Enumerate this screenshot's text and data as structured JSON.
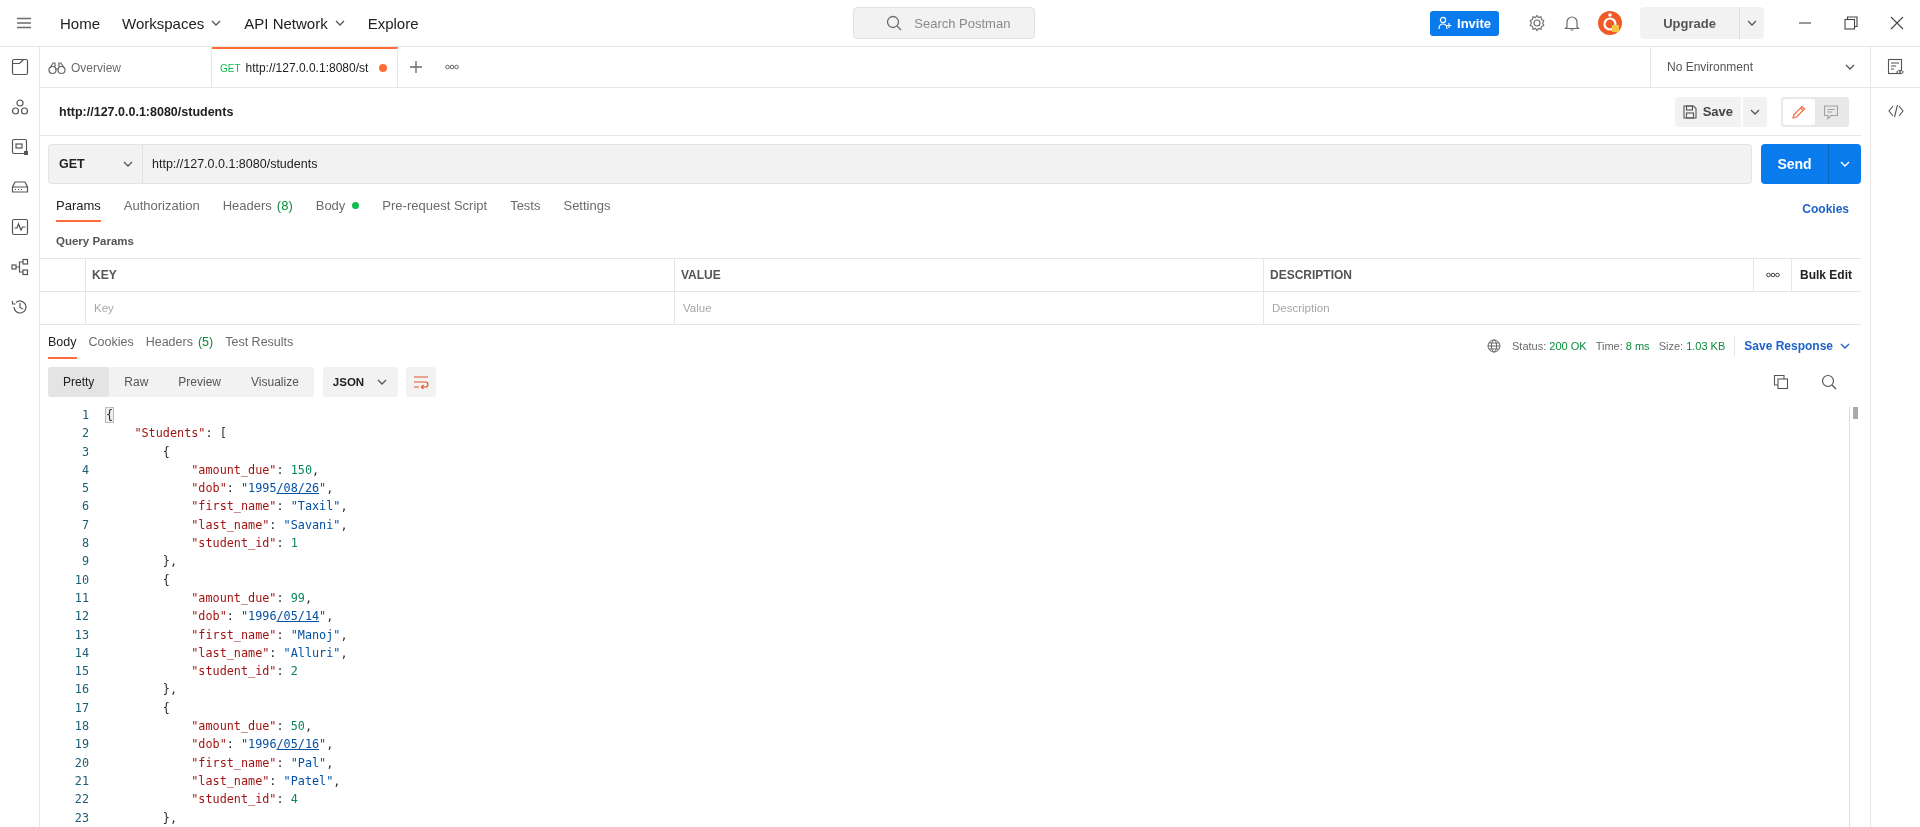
{
  "top_bar": {
    "nav": [
      {
        "label": "Home",
        "dropdown": false
      },
      {
        "label": "Workspaces",
        "dropdown": true
      },
      {
        "label": "API Network",
        "dropdown": true
      },
      {
        "label": "Explore",
        "dropdown": false
      }
    ],
    "search": {
      "placeholder": "Search Postman"
    },
    "invite": "Invite",
    "upgrade": "Upgrade"
  },
  "tabs": [
    {
      "kind": "overview",
      "label": "Overview",
      "selected": false
    },
    {
      "kind": "request",
      "method": "GET",
      "label": "http://127.0.0.1:8080/st",
      "unsaved": true,
      "selected": true
    }
  ],
  "environment": {
    "label": "No Environment"
  },
  "request": {
    "name": "http://127.0.0.1:8080/students",
    "save": "Save",
    "modes": [
      {
        "kind": "edit",
        "selected": true
      },
      {
        "kind": "comments",
        "selected": false
      }
    ],
    "method": "GET",
    "url": "http://127.0.0.1:8080/students",
    "send": "Send",
    "tabs": [
      {
        "label": "Params",
        "selected": true
      },
      {
        "label": "Authorization",
        "selected": false
      },
      {
        "label": "Headers",
        "count": "(8)",
        "selected": false
      },
      {
        "label": "Body",
        "dot": true,
        "selected": false
      },
      {
        "label": "Pre-request Script",
        "selected": false
      },
      {
        "label": "Tests",
        "selected": false
      },
      {
        "label": "Settings",
        "selected": false
      }
    ],
    "cookies": "Cookies"
  },
  "query_params": {
    "title": "Query Params",
    "columns": [
      "KEY",
      "VALUE",
      "DESCRIPTION"
    ],
    "bulk_edit": "Bulk Edit",
    "placeholders": [
      "Key",
      "Value",
      "Description"
    ]
  },
  "response": {
    "tabs": [
      {
        "label": "Body",
        "selected": true
      },
      {
        "label": "Cookies",
        "selected": false
      },
      {
        "label": "Headers",
        "count": "(5)",
        "selected": false
      },
      {
        "label": "Test Results",
        "selected": false
      }
    ],
    "stats": [
      {
        "label": "Status:",
        "value": "200 OK"
      },
      {
        "label": "Time:",
        "value": "8 ms"
      },
      {
        "label": "Size:",
        "value": "1.03 KB"
      }
    ],
    "save_response": "Save Response",
    "views": [
      {
        "label": "Pretty",
        "selected": true
      },
      {
        "label": "Raw",
        "selected": false
      },
      {
        "label": "Preview",
        "selected": false
      },
      {
        "label": "Visualize",
        "selected": false
      }
    ],
    "format": "JSON",
    "lines": [
      {
        "number": "1",
        "tokens": [
          {
            "kind": "brace",
            "text": "{"
          }
        ]
      },
      {
        "number": "2",
        "tokens": [
          {
            "kind": "key",
            "text": "    \"Students\""
          },
          {
            "kind": "punct",
            "text": ": ["
          }
        ]
      },
      {
        "number": "3",
        "tokens": [
          {
            "kind": "punct",
            "text": "        {"
          }
        ]
      },
      {
        "number": "4",
        "tokens": [
          {
            "kind": "key",
            "text": "            \"amount_due\""
          },
          {
            "kind": "punct",
            "text": ": "
          },
          {
            "kind": "number",
            "text": "150"
          },
          {
            "kind": "punct",
            "text": ","
          }
        ]
      },
      {
        "number": "5",
        "tokens": [
          {
            "kind": "key",
            "text": "            \"dob\""
          },
          {
            "kind": "punct",
            "text": ": "
          },
          {
            "kind": "string",
            "text": "\"1995"
          },
          {
            "kind": "link",
            "text": "/08/26"
          },
          {
            "kind": "string",
            "text": "\""
          },
          {
            "kind": "punct",
            "text": ","
          }
        ]
      },
      {
        "number": "6",
        "tokens": [
          {
            "kind": "key",
            "text": "            \"first_name\""
          },
          {
            "kind": "punct",
            "text": ": "
          },
          {
            "kind": "string",
            "text": "\"Taxil\""
          },
          {
            "kind": "punct",
            "text": ","
          }
        ]
      },
      {
        "number": "7",
        "tokens": [
          {
            "kind": "key",
            "text": "            \"last_name\""
          },
          {
            "kind": "punct",
            "text": ": "
          },
          {
            "kind": "string",
            "text": "\"Savani\""
          },
          {
            "kind": "punct",
            "text": ","
          }
        ]
      },
      {
        "number": "8",
        "tokens": [
          {
            "kind": "key",
            "text": "            \"student_id\""
          },
          {
            "kind": "punct",
            "text": ": "
          },
          {
            "kind": "number",
            "text": "1"
          }
        ]
      },
      {
        "number": "9",
        "tokens": [
          {
            "kind": "punct",
            "text": "        },"
          }
        ]
      },
      {
        "number": "10",
        "tokens": [
          {
            "kind": "punct",
            "text": "        {"
          }
        ]
      },
      {
        "number": "11",
        "tokens": [
          {
            "kind": "key",
            "text": "            \"amount_due\""
          },
          {
            "kind": "punct",
            "text": ": "
          },
          {
            "kind": "number",
            "text": "99"
          },
          {
            "kind": "punct",
            "text": ","
          }
        ]
      },
      {
        "number": "12",
        "tokens": [
          {
            "kind": "key",
            "text": "            \"dob\""
          },
          {
            "kind": "punct",
            "text": ": "
          },
          {
            "kind": "string",
            "text": "\"1996"
          },
          {
            "kind": "link",
            "text": "/05/14"
          },
          {
            "kind": "string",
            "text": "\""
          },
          {
            "kind": "punct",
            "text": ","
          }
        ]
      },
      {
        "number": "13",
        "tokens": [
          {
            "kind": "key",
            "text": "            \"first_name\""
          },
          {
            "kind": "punct",
            "text": ": "
          },
          {
            "kind": "string",
            "text": "\"Manoj\""
          },
          {
            "kind": "punct",
            "text": ","
          }
        ]
      },
      {
        "number": "14",
        "tokens": [
          {
            "kind": "key",
            "text": "            \"last_name\""
          },
          {
            "kind": "punct",
            "text": ": "
          },
          {
            "kind": "string",
            "text": "\"Alluri\""
          },
          {
            "kind": "punct",
            "text": ","
          }
        ]
      },
      {
        "number": "15",
        "tokens": [
          {
            "kind": "key",
            "text": "            \"student_id\""
          },
          {
            "kind": "punct",
            "text": ": "
          },
          {
            "kind": "number",
            "text": "2"
          }
        ]
      },
      {
        "number": "16",
        "tokens": [
          {
            "kind": "punct",
            "text": "        },"
          }
        ]
      },
      {
        "number": "17",
        "tokens": [
          {
            "kind": "punct",
            "text": "        {"
          }
        ]
      },
      {
        "number": "18",
        "tokens": [
          {
            "kind": "key",
            "text": "            \"amount_due\""
          },
          {
            "kind": "punct",
            "text": ": "
          },
          {
            "kind": "number",
            "text": "50"
          },
          {
            "kind": "punct",
            "text": ","
          }
        ]
      },
      {
        "number": "19",
        "tokens": [
          {
            "kind": "key",
            "text": "            \"dob\""
          },
          {
            "kind": "punct",
            "text": ": "
          },
          {
            "kind": "string",
            "text": "\"1996"
          },
          {
            "kind": "link",
            "text": "/05/16"
          },
          {
            "kind": "string",
            "text": "\""
          },
          {
            "kind": "punct",
            "text": ","
          }
        ]
      },
      {
        "number": "20",
        "tokens": [
          {
            "kind": "key",
            "text": "            \"first_name\""
          },
          {
            "kind": "punct",
            "text": ": "
          },
          {
            "kind": "string",
            "text": "\"Pal\""
          },
          {
            "kind": "punct",
            "text": ","
          }
        ]
      },
      {
        "number": "21",
        "tokens": [
          {
            "kind": "key",
            "text": "            \"last_name\""
          },
          {
            "kind": "punct",
            "text": ": "
          },
          {
            "kind": "string",
            "text": "\"Patel\""
          },
          {
            "kind": "punct",
            "text": ","
          }
        ]
      },
      {
        "number": "22",
        "tokens": [
          {
            "kind": "key",
            "text": "            \"student_id\""
          },
          {
            "kind": "punct",
            "text": ": "
          },
          {
            "kind": "number",
            "text": "4"
          }
        ]
      },
      {
        "number": "23",
        "tokens": [
          {
            "kind": "punct",
            "text": "        },"
          }
        ]
      }
    ]
  }
}
